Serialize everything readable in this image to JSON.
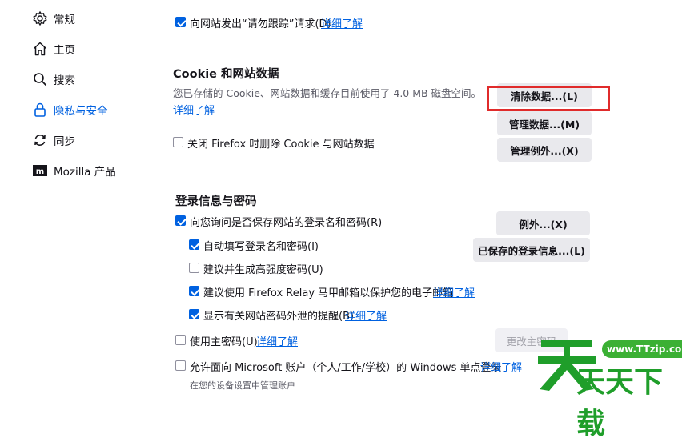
{
  "sidebar": {
    "items": [
      {
        "label": "常规",
        "icon": "gear-icon"
      },
      {
        "label": "主页",
        "icon": "home-icon"
      },
      {
        "label": "搜索",
        "icon": "search-icon"
      },
      {
        "label": "隐私与安全",
        "icon": "lock-icon",
        "active": true
      },
      {
        "label": "同步",
        "icon": "sync-icon"
      },
      {
        "label": "Mozilla 产品",
        "icon": "mozilla-icon"
      }
    ]
  },
  "dnt": {
    "label": "向网站发出“请勿跟踪”请求(D)",
    "checked": true,
    "link": "详细了解"
  },
  "cookies": {
    "title": "Cookie 和网站数据",
    "desc": "您已存储的 Cookie、网站数据和缓存目前使用了 4.0 MB 磁盘空间。",
    "learn_more": "详细了解",
    "delete_on_close": "关闭 Firefox 时删除 Cookie 与网站数据",
    "buttons": {
      "clear": "清除数据...(L)",
      "manage": "管理数据...(M)",
      "exceptions": "管理例外...(X)"
    }
  },
  "logins": {
    "title": "登录信息与密码",
    "ask_save": "向您询问是否保存网站的登录名和密码(R)",
    "autofill": "自动填写登录名和密码(I)",
    "suggest_strong": "建议并生成高强度密码(U)",
    "relay": "建议使用 Firefox Relay 马甲邮箱以保护您的电子邮箱",
    "relay_link": "详细了解",
    "breach_alerts": "显示有关网站密码外泄的提醒(B)",
    "breach_link": "详细了解",
    "primary_password": "使用主密码(U)",
    "primary_link": "详细了解",
    "windows_sso": "允许面向 Microsoft 账户（个人/工作/学校）的 Windows 单点登录",
    "windows_link": "详细了解",
    "managed_note": "在您的设备设置中管理账户",
    "buttons": {
      "exceptions": "例外...(X)",
      "saved_logins": "已保存的登录信息...(L)",
      "change_primary": "更改主密码"
    }
  },
  "watermark": {
    "url": "www.TTzip.com",
    "brand": "天天下载"
  },
  "colors": {
    "accent": "#0061e0",
    "highlight": "#e02b2b",
    "watermark_green": "#1f9e2a"
  }
}
